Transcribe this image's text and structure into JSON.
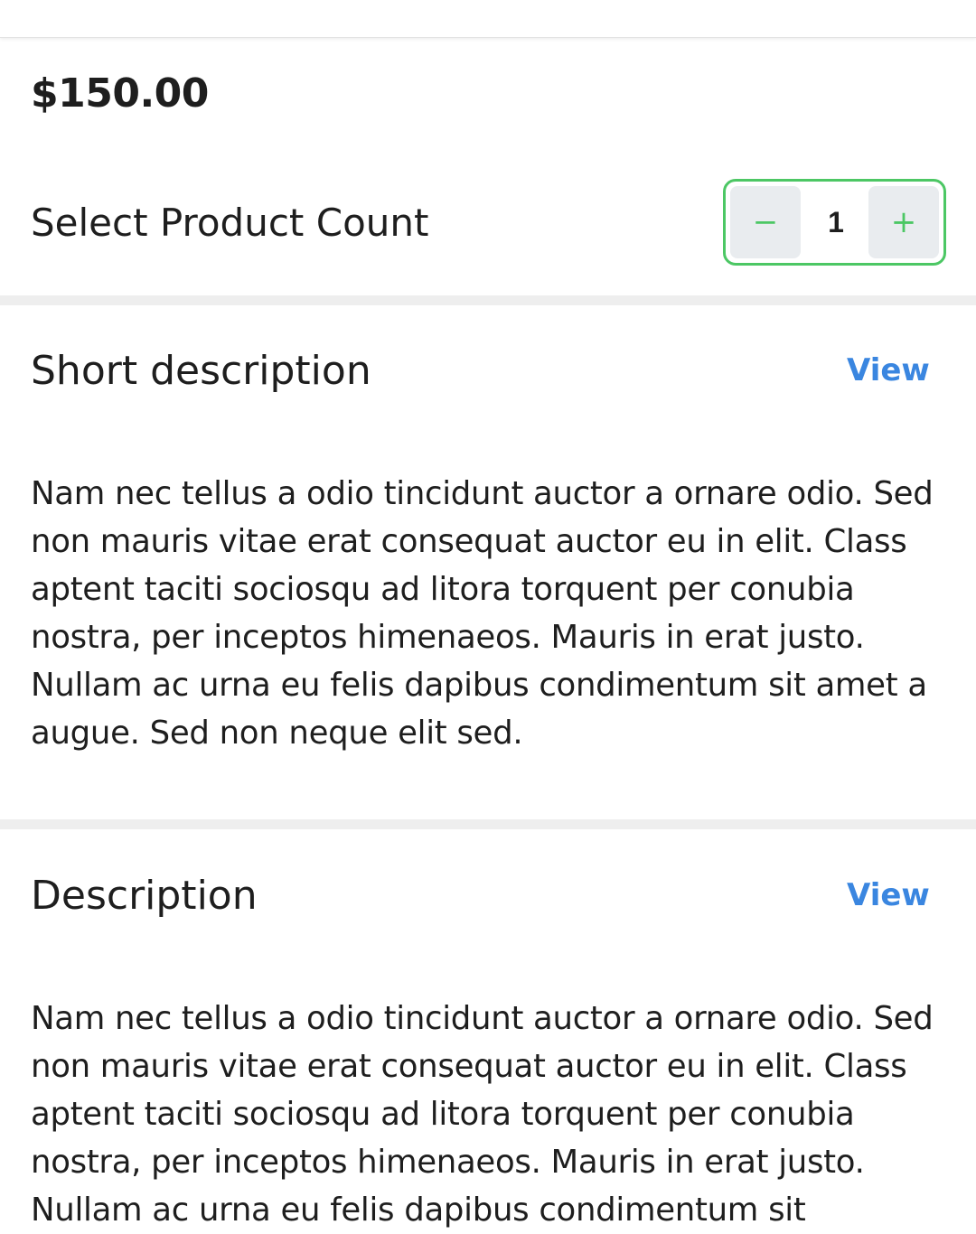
{
  "product": {
    "price": "$150.00",
    "count_label": "Select Product Count",
    "quantity": "1",
    "minus_symbol": "−",
    "plus_symbol": "+"
  },
  "sections": [
    {
      "title": "Short description",
      "link": "View",
      "text": "Nam nec tellus a odio tincidunt auctor a ornare odio. Sed non mauris vitae erat consequat auctor eu in elit. Class aptent taciti sociosqu ad litora torquent per conubia nostra, per inceptos himenaeos. Mauris in erat justo. Nullam ac urna eu felis dapibus condimentum sit amet a augue. Sed non neque elit sed."
    },
    {
      "title": "Description",
      "link": "View",
      "text": "Nam nec tellus a odio tincidunt auctor a ornare odio. Sed non mauris vitae erat consequat auctor eu in elit. Class aptent taciti sociosqu ad litora torquent per conubia nostra, per inceptos himenaeos. Mauris in erat justo. Nullam ac urna eu felis dapibus condimentum sit"
    }
  ],
  "colors": {
    "accent_green": "#4cc764",
    "link_blue": "#3a86e0",
    "stepper_button_bg": "#e9ecef",
    "divider": "#eeeeee"
  }
}
